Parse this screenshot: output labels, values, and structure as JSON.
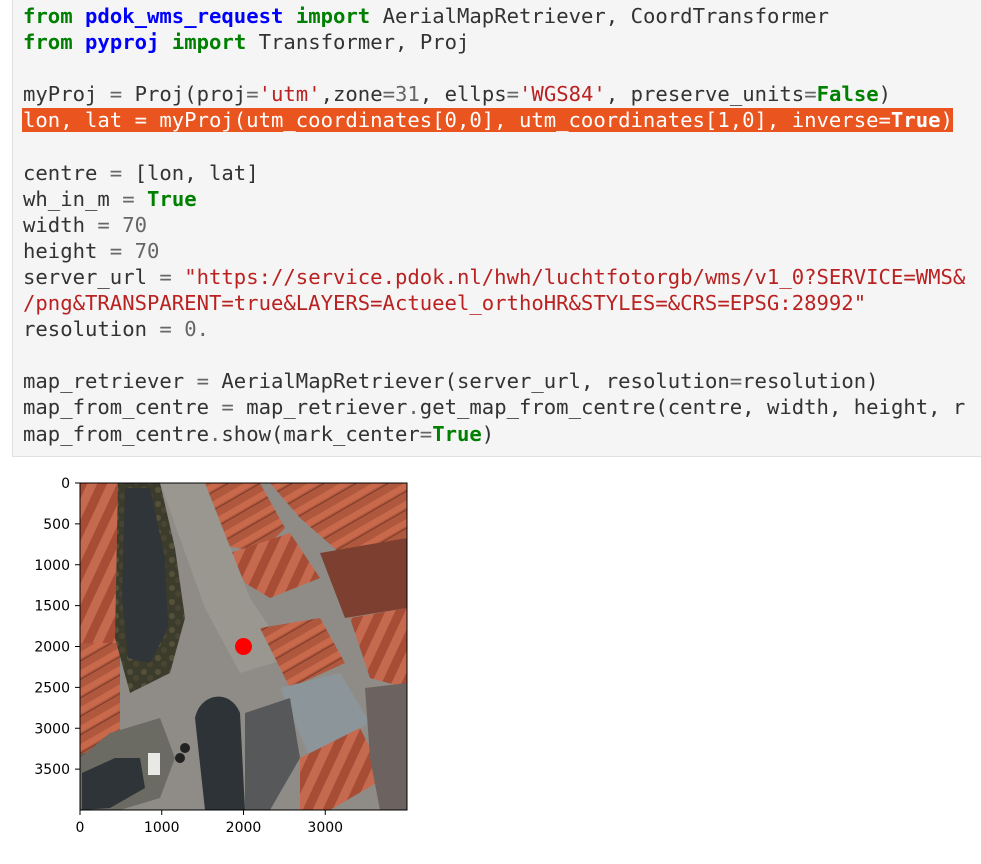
{
  "code_lines": [
    [
      {
        "t": "from",
        "c": "kw"
      },
      {
        "t": " "
      },
      {
        "t": "pdok_wms_request",
        "c": "mod"
      },
      {
        "t": " "
      },
      {
        "t": "import",
        "c": "kw"
      },
      {
        "t": " AerialMapRetriever, CoordTransformer"
      }
    ],
    [
      {
        "t": "from",
        "c": "kw"
      },
      {
        "t": " "
      },
      {
        "t": "pyproj",
        "c": "mod"
      },
      {
        "t": " "
      },
      {
        "t": "import",
        "c": "kw"
      },
      {
        "t": " Transformer, Proj"
      }
    ],
    [],
    [
      {
        "t": "myProj "
      },
      {
        "t": "=",
        "c": "op"
      },
      {
        "t": " Proj(proj"
      },
      {
        "t": "=",
        "c": "op"
      },
      {
        "t": "'utm'",
        "c": "str"
      },
      {
        "t": ",zone"
      },
      {
        "t": "=",
        "c": "op"
      },
      {
        "t": "31",
        "c": "num"
      },
      {
        "t": ", ellps"
      },
      {
        "t": "=",
        "c": "op"
      },
      {
        "t": "'WGS84'",
        "c": "str"
      },
      {
        "t": ", preserve_units"
      },
      {
        "t": "=",
        "c": "op"
      },
      {
        "t": "False",
        "c": "kw"
      },
      {
        "t": ")"
      }
    ],
    [
      {
        "t": "lon, lat = myProj(utm_coordinates[0,0], utm_coordinates[1,0], inverse="
      },
      {
        "t": "True",
        "c": "kw"
      },
      {
        "t": ")"
      }
    ],
    [],
    [
      {
        "t": "centre "
      },
      {
        "t": "=",
        "c": "op"
      },
      {
        "t": " [lon, lat]"
      }
    ],
    [
      {
        "t": "wh_in_m "
      },
      {
        "t": "=",
        "c": "op"
      },
      {
        "t": " "
      },
      {
        "t": "True",
        "c": "kw"
      }
    ],
    [
      {
        "t": "width "
      },
      {
        "t": "=",
        "c": "op"
      },
      {
        "t": " "
      },
      {
        "t": "70",
        "c": "num"
      }
    ],
    [
      {
        "t": "height "
      },
      {
        "t": "=",
        "c": "op"
      },
      {
        "t": " "
      },
      {
        "t": "70",
        "c": "num"
      }
    ],
    [
      {
        "t": "server_url "
      },
      {
        "t": "=",
        "c": "op"
      },
      {
        "t": " "
      },
      {
        "t": "\"https://service.pdok.nl/hwh/luchtfotorgb/wms/v1_0?SERVICE=WMS&",
        "c": "str"
      }
    ],
    [
      {
        "t": "/png&TRANSPARENT=true&LAYERS=Actueel_orthoHR&STYLES=&CRS=EPSG:28992\"",
        "c": "str"
      }
    ],
    [
      {
        "t": "resolution "
      },
      {
        "t": "=",
        "c": "op"
      },
      {
        "t": " "
      },
      {
        "t": "0.",
        "c": "num"
      }
    ],
    [],
    [
      {
        "t": "map_retriever "
      },
      {
        "t": "=",
        "c": "op"
      },
      {
        "t": " AerialMapRetriever(server_url, resolution"
      },
      {
        "t": "=",
        "c": "op"
      },
      {
        "t": "resolution)"
      }
    ],
    [
      {
        "t": "map_from_centre "
      },
      {
        "t": "=",
        "c": "op"
      },
      {
        "t": " map_retriever"
      },
      {
        "t": ".",
        "c": "op"
      },
      {
        "t": "get_map_from_centre(centre, width, height, r"
      }
    ],
    [
      {
        "t": "map_from_centre"
      },
      {
        "t": ".",
        "c": "op"
      },
      {
        "t": "show(mark_center"
      },
      {
        "t": "=",
        "c": "op"
      },
      {
        "t": "True",
        "c": "kw"
      },
      {
        "t": ")"
      }
    ]
  ],
  "highlighted_line": 4,
  "chart_data": {
    "type": "image",
    "x_ticks": [
      "0",
      "1000",
      "2000",
      "3000"
    ],
    "y_ticks": [
      "0",
      "500",
      "1000",
      "1500",
      "2000",
      "2500",
      "3000",
      "3500"
    ],
    "xlim": [
      0,
      4000
    ],
    "ylim": [
      4000,
      0
    ],
    "marker": {
      "x": 2000,
      "y": 2000,
      "color": "#ff0000"
    }
  }
}
